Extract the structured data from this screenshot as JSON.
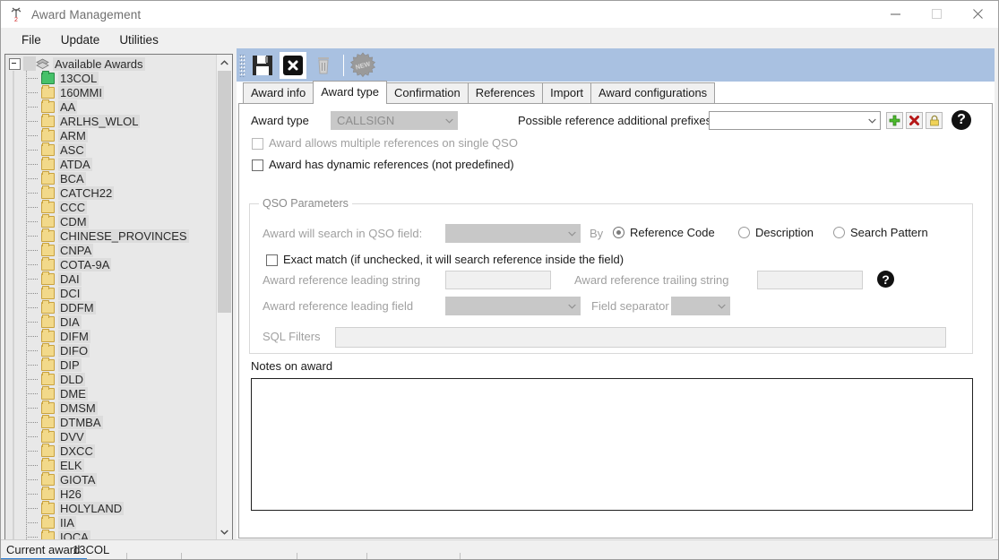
{
  "window": {
    "title": "Award Management",
    "icon": "antenna-icon",
    "controls": {
      "minimize": "minimize-icon",
      "maximize": "maximize-icon",
      "close": "close-icon"
    }
  },
  "menubar": {
    "items": [
      "File",
      "Update",
      "Utilities"
    ]
  },
  "tree": {
    "root": {
      "label": "Available Awards",
      "expanded": true,
      "icon": "awards-root-icon"
    },
    "selected": "13COL",
    "items": [
      "13COL",
      "160MMI",
      "AA",
      "ARLHS_WLOL",
      "ARM",
      "ASC",
      "ATDA",
      "BCA",
      "CATCH22",
      "CCC",
      "CDM",
      "CHINESE_PROVINCES",
      "CNPA",
      "COTA-9A",
      "DAI",
      "DCI",
      "DDFM",
      "DIA",
      "DIFM",
      "DIFO",
      "DIP",
      "DLD",
      "DME",
      "DMSM",
      "DTMBA",
      "DVV",
      "DXCC",
      "ELK",
      "GIOTA",
      "H26",
      "HOLYLAND",
      "IIA",
      "IOCA"
    ],
    "scrollbar": {
      "up": "scroll-up-icon",
      "down": "scroll-down-icon"
    }
  },
  "toolbar": {
    "buttons": [
      {
        "name": "save-button",
        "icon": "floppy-disk-icon",
        "enabled": true
      },
      {
        "name": "cancel-button",
        "icon": "cancel-x-icon",
        "enabled": true
      },
      {
        "name": "delete-button",
        "icon": "trash-icon",
        "enabled": false
      },
      {
        "name": "new-button",
        "icon": "new-badge-icon",
        "label": "NEW",
        "enabled": false
      }
    ]
  },
  "tabs": {
    "items": [
      "Award info",
      "Award type",
      "Confirmation",
      "References",
      "Import",
      "Award configurations"
    ],
    "active": "Award type"
  },
  "form": {
    "award_type_label": "Award type",
    "award_type_value": "CALLSIGN",
    "prefixes_label": "Possible reference additional prefixes",
    "prefixes_value": "",
    "prefix_add_icon": "plus-icon",
    "prefix_delete_icon": "red-x-icon",
    "prefix_lock_icon": "lock-icon",
    "help_icon": "help-question-icon",
    "checkbox_multiple": {
      "label": "Award allows multiple references on single QSO",
      "checked": false,
      "enabled": false
    },
    "checkbox_dynamic": {
      "label": "Award has dynamic references (not predefined)",
      "checked": false,
      "enabled": true
    },
    "qso_group": {
      "title": "QSO Parameters",
      "search_field_label": "Award will search in QSO field:",
      "search_field_value": "",
      "by_label": "By",
      "radios": [
        {
          "label": "Reference Code",
          "selected": true
        },
        {
          "label": "Description",
          "selected": false
        },
        {
          "label": "Search Pattern",
          "selected": false
        }
      ],
      "exact_match": {
        "label": "Exact match (if unchecked, it will search reference inside the field)",
        "checked": false
      },
      "leading_string_label": "Award reference leading string",
      "leading_string_value": "",
      "trailing_string_label": "Award reference trailing string",
      "trailing_string_value": "",
      "leading_field_label": "Award reference leading field",
      "leading_field_value": "",
      "field_separator_label": "Field separator",
      "field_separator_value": "",
      "sql_filters_label": "SQL Filters",
      "sql_filters_value": "",
      "help_icon": "help-question-icon"
    },
    "notes_label": "Notes on award",
    "notes_value": ""
  },
  "statusbar": {
    "label": "Current award",
    "value": "13COL"
  }
}
